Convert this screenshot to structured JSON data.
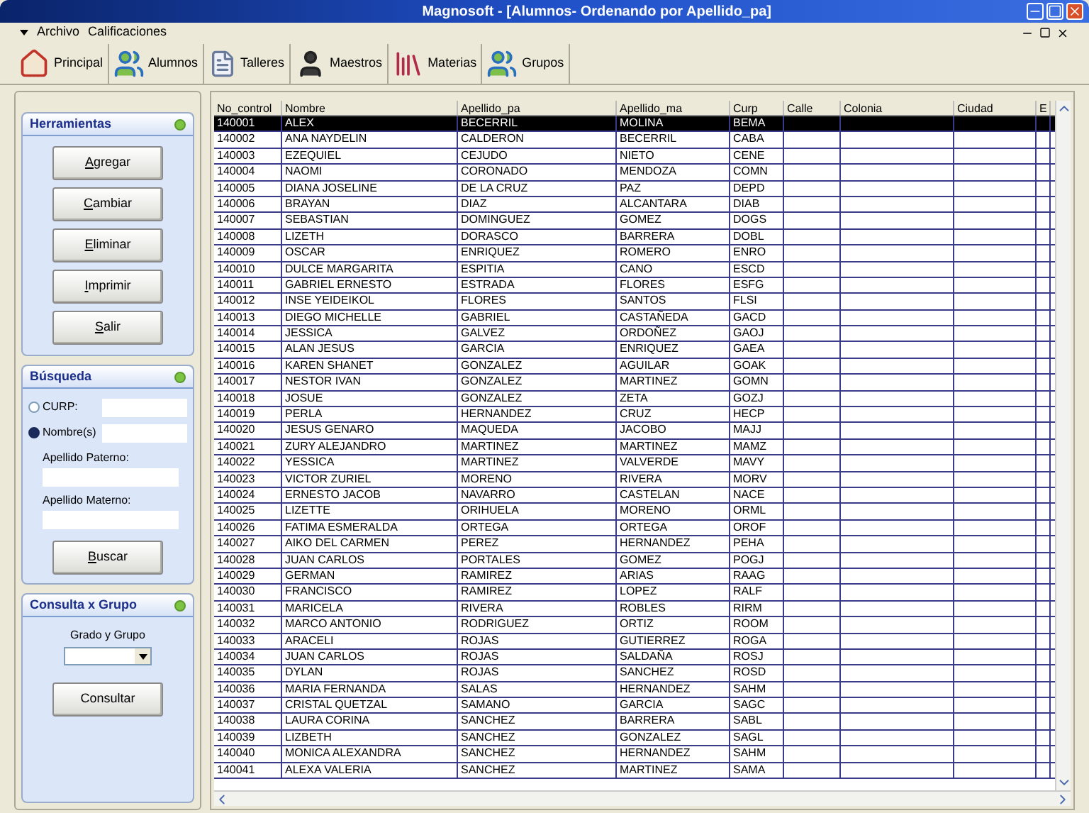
{
  "window": {
    "title": "Magnosoft - [Alumnos- Ordenando por Apellido_pa]"
  },
  "menu": [
    "Archivo",
    "Calificaciones"
  ],
  "toolbar": [
    {
      "label": "Principal",
      "kind": "house"
    },
    {
      "label": "Alumnos",
      "kind": "people"
    },
    {
      "label": "Talleres",
      "kind": "paper"
    },
    {
      "label": "Maestros",
      "kind": "person"
    },
    {
      "label": "Materias",
      "kind": "books"
    },
    {
      "label": "Grupos",
      "kind": "people"
    }
  ],
  "herramientas": {
    "title": "Herramientas",
    "buttons": [
      {
        "label": "Agregar",
        "underline_first": true
      },
      {
        "label": "Cambiar",
        "underline_first": true
      },
      {
        "label": "Eliminar",
        "underline_first": true
      },
      {
        "label": "Imprimir",
        "underline_first": true
      },
      {
        "label": "Salir",
        "underline_first": true
      }
    ]
  },
  "busqueda": {
    "title": "Búsqueda",
    "options": [
      {
        "label": "CURP:",
        "selected": false
      },
      {
        "label": "Nombre(s)",
        "selected": true
      }
    ],
    "fields": [
      {
        "label": "Apellido Paterno:"
      },
      {
        "label": "Apellido Materno:"
      }
    ],
    "button": {
      "label": "Buscar",
      "underline_first": true
    }
  },
  "consulta": {
    "title": "Consulta x Grupo",
    "field_label": "Grado y Grupo",
    "button": {
      "label": "Consultar",
      "underline_first": false
    }
  },
  "table": {
    "columns": [
      "No_control",
      "Nombre",
      "Apellido_pa",
      "Apellido_ma",
      "Curp",
      "Calle",
      "Colonia",
      "Ciudad",
      "E"
    ],
    "rows": [
      {
        "cells": [
          "140001",
          "ALEX",
          "BECERRIL",
          "MOLINA",
          "BEMA"
        ],
        "selected": true
      },
      {
        "cells": [
          "140002",
          "ANA NAYDELIN",
          "CALDERON",
          "BECERRIL",
          "CABA"
        ],
        "selected": false
      },
      {
        "cells": [
          "140003",
          "EZEQUIEL",
          "CEJUDO",
          "NIETO",
          "CENE"
        ],
        "selected": false
      },
      {
        "cells": [
          "140004",
          "NAOMI",
          "CORONADO",
          "MENDOZA",
          "COMN"
        ],
        "selected": false
      },
      {
        "cells": [
          "140005",
          "DIANA JOSELINE",
          "DE LA CRUZ",
          "PAZ",
          "DEPD"
        ],
        "selected": false
      },
      {
        "cells": [
          "140006",
          "BRAYAN",
          "DIAZ",
          "ALCANTARA",
          "DIAB"
        ],
        "selected": false
      },
      {
        "cells": [
          "140007",
          "SEBASTIAN",
          "DOMINGUEZ",
          "GOMEZ",
          "DOGS"
        ],
        "selected": false
      },
      {
        "cells": [
          "140008",
          "LIZETH",
          "DORASCO",
          "BARRERA",
          "DOBL"
        ],
        "selected": false
      },
      {
        "cells": [
          "140009",
          "OSCAR",
          "ENRIQUEZ",
          "ROMERO",
          "ENRO"
        ],
        "selected": false
      },
      {
        "cells": [
          "140010",
          "DULCE MARGARITA",
          "ESPITIA",
          "CANO",
          "ESCD"
        ],
        "selected": false
      },
      {
        "cells": [
          "140011",
          "GABRIEL ERNESTO",
          "ESTRADA",
          "FLORES",
          "ESFG"
        ],
        "selected": false
      },
      {
        "cells": [
          "140012",
          "INSE YEIDEIKOL",
          "FLORES",
          "SANTOS",
          "FLSI"
        ],
        "selected": false
      },
      {
        "cells": [
          "140013",
          "DIEGO MICHELLE",
          "GABRIEL",
          "CASTAÑEDA",
          "GACD"
        ],
        "selected": false
      },
      {
        "cells": [
          "140014",
          "JESSICA",
          "GALVEZ",
          "ORDOÑEZ",
          "GAOJ"
        ],
        "selected": false
      },
      {
        "cells": [
          "140015",
          "ALAN JESUS",
          "GARCIA",
          "ENRIQUEZ",
          "GAEA"
        ],
        "selected": false
      },
      {
        "cells": [
          "140016",
          "KAREN SHANET",
          "GONZALEZ",
          "AGUILAR",
          "GOAK"
        ],
        "selected": false
      },
      {
        "cells": [
          "140017",
          "NESTOR IVAN",
          "GONZALEZ",
          "MARTINEZ",
          "GOMN"
        ],
        "selected": false
      },
      {
        "cells": [
          "140018",
          "JOSUE",
          "GONZALEZ",
          "ZETA",
          "GOZJ"
        ],
        "selected": false
      },
      {
        "cells": [
          "140019",
          "PERLA",
          "HERNANDEZ",
          "CRUZ",
          "HECP"
        ],
        "selected": false
      },
      {
        "cells": [
          "140020",
          "JESUS GENARO",
          "MAQUEDA",
          "JACOBO",
          "MAJJ"
        ],
        "selected": false
      },
      {
        "cells": [
          "140021",
          "ZURY ALEJANDRO",
          "MARTINEZ",
          "MARTINEZ",
          "MAMZ"
        ],
        "selected": false
      },
      {
        "cells": [
          "140022",
          "YESSICA",
          "MARTINEZ",
          "VALVERDE",
          "MAVY"
        ],
        "selected": false
      },
      {
        "cells": [
          "140023",
          "VICTOR ZURIEL",
          "MORENO",
          "RIVERA",
          "MORV"
        ],
        "selected": false
      },
      {
        "cells": [
          "140024",
          "ERNESTO JACOB",
          "NAVARRO",
          "CASTELAN",
          "NACE"
        ],
        "selected": false
      },
      {
        "cells": [
          "140025",
          "LIZETTE",
          "ORIHUELA",
          "MORENO",
          "ORML"
        ],
        "selected": false
      },
      {
        "cells": [
          "140026",
          "FATIMA ESMERALDA",
          "ORTEGA",
          "ORTEGA",
          "OROF"
        ],
        "selected": false
      },
      {
        "cells": [
          "140027",
          "AIKO DEL CARMEN",
          "PEREZ",
          "HERNANDEZ",
          "PEHA"
        ],
        "selected": false
      },
      {
        "cells": [
          "140028",
          "JUAN CARLOS",
          "PORTALES",
          "GOMEZ",
          "POGJ"
        ],
        "selected": false
      },
      {
        "cells": [
          "140029",
          "GERMAN",
          "RAMIREZ",
          "ARIAS",
          "RAAG"
        ],
        "selected": false
      },
      {
        "cells": [
          "140030",
          "FRANCISCO",
          "RAMIREZ",
          "LOPEZ",
          "RALF"
        ],
        "selected": false
      },
      {
        "cells": [
          "140031",
          "MARICELA",
          "RIVERA",
          "ROBLES",
          "RIRM"
        ],
        "selected": false
      },
      {
        "cells": [
          "140032",
          "MARCO ANTONIO",
          "RODRIGUEZ",
          "ORTIZ",
          "ROOM"
        ],
        "selected": false
      },
      {
        "cells": [
          "140033",
          "ARACELI",
          "ROJAS",
          "GUTIERREZ",
          "ROGA"
        ],
        "selected": false
      },
      {
        "cells": [
          "140034",
          "JUAN CARLOS",
          "ROJAS",
          "SALDAÑA",
          "ROSJ"
        ],
        "selected": false
      },
      {
        "cells": [
          "140035",
          "DYLAN",
          "ROJAS",
          "SANCHEZ",
          "ROSD"
        ],
        "selected": false
      },
      {
        "cells": [
          "140036",
          "MARIA FERNANDA",
          "SALAS",
          "HERNANDEZ",
          "SAHM"
        ],
        "selected": false
      },
      {
        "cells": [
          "140037",
          "CRISTAL QUETZAL",
          "SAMANO",
          "GARCIA",
          "SAGC"
        ],
        "selected": false
      },
      {
        "cells": [
          "140038",
          "LAURA CORINA",
          "SANCHEZ",
          "BARRERA",
          "SABL"
        ],
        "selected": false
      },
      {
        "cells": [
          "140039",
          "LIZBETH",
          "SANCHEZ",
          "GONZALEZ",
          "SAGL"
        ],
        "selected": false
      },
      {
        "cells": [
          "140040",
          "MONICA ALEXANDRA",
          "SANCHEZ",
          "HERNANDEZ",
          "SAHM"
        ],
        "selected": false
      },
      {
        "cells": [
          "140041",
          "ALEXA VALERIA",
          "SANCHEZ",
          "MARTINEZ",
          "SAMA"
        ],
        "selected": false
      }
    ]
  }
}
